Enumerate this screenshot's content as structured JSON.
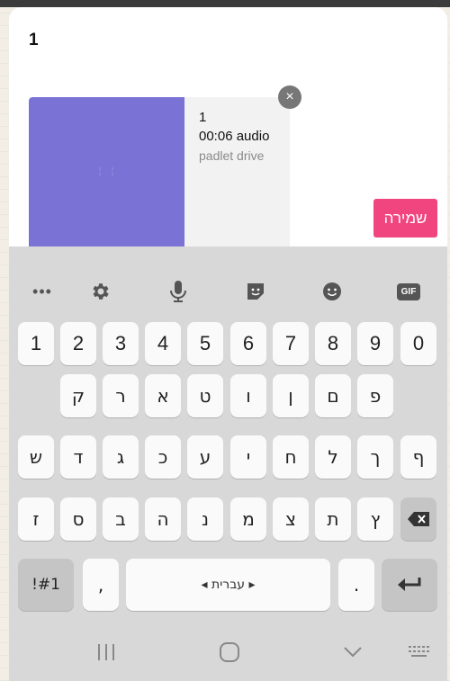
{
  "post": {
    "title": "1"
  },
  "attachment": {
    "name": "1",
    "meta": "00:06 audio",
    "source": "padlet drive",
    "thumb_color": "#7b72d6"
  },
  "actions": {
    "remove_label": "×",
    "save_label": "שמירה"
  },
  "toolbar": {
    "items": [
      {
        "icon": "more-dots-icon",
        "label": "•••"
      },
      {
        "icon": "gear-icon"
      },
      {
        "icon": "microphone-icon"
      },
      {
        "icon": "sticker-icon"
      },
      {
        "icon": "emoji-icon"
      },
      {
        "icon": "gif-icon",
        "label": "GIF"
      }
    ]
  },
  "keyboard": {
    "row_digits": [
      "1",
      "2",
      "3",
      "4",
      "5",
      "6",
      "7",
      "8",
      "9",
      "0"
    ],
    "row1": [
      "ק",
      "ר",
      "א",
      "ט",
      "ו",
      "ן",
      "ם",
      "פ"
    ],
    "row2": [
      "ש",
      "ד",
      "ג",
      "כ",
      "ע",
      "י",
      "ח",
      "ל",
      "ך",
      "ף"
    ],
    "row3": [
      "ז",
      "ס",
      "ב",
      "ה",
      "נ",
      "מ",
      "צ",
      "ת",
      "ץ"
    ],
    "symbols_label": "!#1",
    "comma": ",",
    "space_label": "◂ עברית ▸",
    "period": "."
  },
  "colors": {
    "accent": "#f0457f",
    "keyboard_bg": "#d8d8d8",
    "key_bg": "#fafafa"
  }
}
